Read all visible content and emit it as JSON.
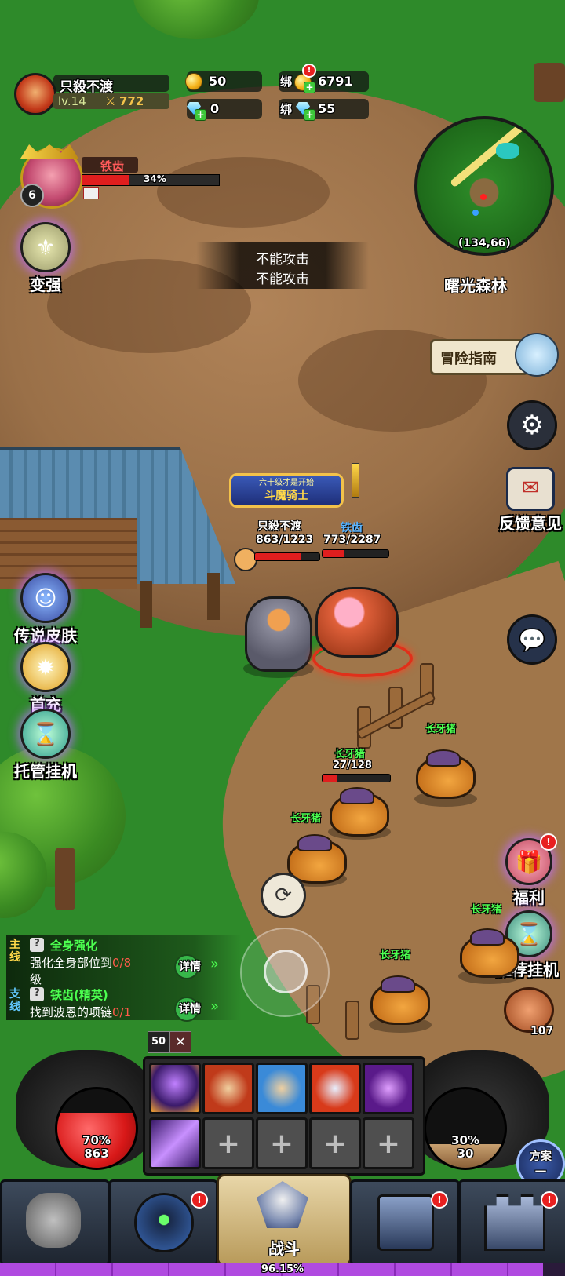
{
  "player": {
    "name": "只殺不渡",
    "level": "lv.14",
    "power": "772"
  },
  "currency": {
    "gold": "50",
    "bound_gold_label": "绑",
    "bound_gold": "6791",
    "diamond": "0",
    "bound_diamond_label": "绑",
    "bound_diamond": "55",
    "alert": "!"
  },
  "boss": {
    "name": "铁齿",
    "hp_percent_label": "34%",
    "hp_fraction": 0.34,
    "level": "6"
  },
  "minimap": {
    "coords": "(134,66)",
    "zone_name": "曙光森林"
  },
  "message": {
    "line1": "不能攻击",
    "line2": "不能攻击"
  },
  "left_menu": {
    "strengthen": "变强",
    "legend_skin": "传说皮肤",
    "first_recharge": "首充",
    "auto_idle": "托管挂机"
  },
  "right_menu": {
    "guide": "冒险指南",
    "feedback": "反馈意见",
    "welfare": "福利",
    "recommend_idle": "推荐挂机",
    "item_count": "107",
    "plan_label": "方案",
    "plan_value": "一"
  },
  "scene": {
    "banner_top": "六十级才是开始",
    "banner_main": "斗魔骑士",
    "player_name": "只殺不渡",
    "player_hp": "863/1223",
    "player_hp_fraction": 0.706,
    "enemy_name": "铁齿",
    "enemy_hp": "773/2287",
    "enemy_hp_fraction": 0.338,
    "mob_name": "长牙猪",
    "mob_hp": "27/128",
    "mob_hp_fraction": 0.21
  },
  "quests": {
    "main_tag": "主线",
    "main_title": "全身强化",
    "main_desc": "强化全身部位到",
    "main_progress": "0/8",
    "main_desc_tail": "级",
    "main_detail": "详情",
    "side_tag": "支线",
    "side_title": "铁齿(精英)",
    "side_desc": "找到波恩的项链",
    "side_progress": "0/1",
    "side_detail": "详情"
  },
  "combat": {
    "buff_count": "50",
    "hp_percent": "70%",
    "hp_value": "863",
    "mp_percent": "30%",
    "mp_value": "30",
    "hp_fraction": 0.7,
    "mp_fraction": 0.3
  },
  "bottom_nav": {
    "fight_label": "战斗",
    "exp_label": "96.15%",
    "exp_fraction": 0.9615
  },
  "colors": {
    "hp_red": "#e01e1e",
    "exp_purple": "#b04ae0",
    "mob_green": "#4cff50",
    "gold": "#f4b21a"
  }
}
